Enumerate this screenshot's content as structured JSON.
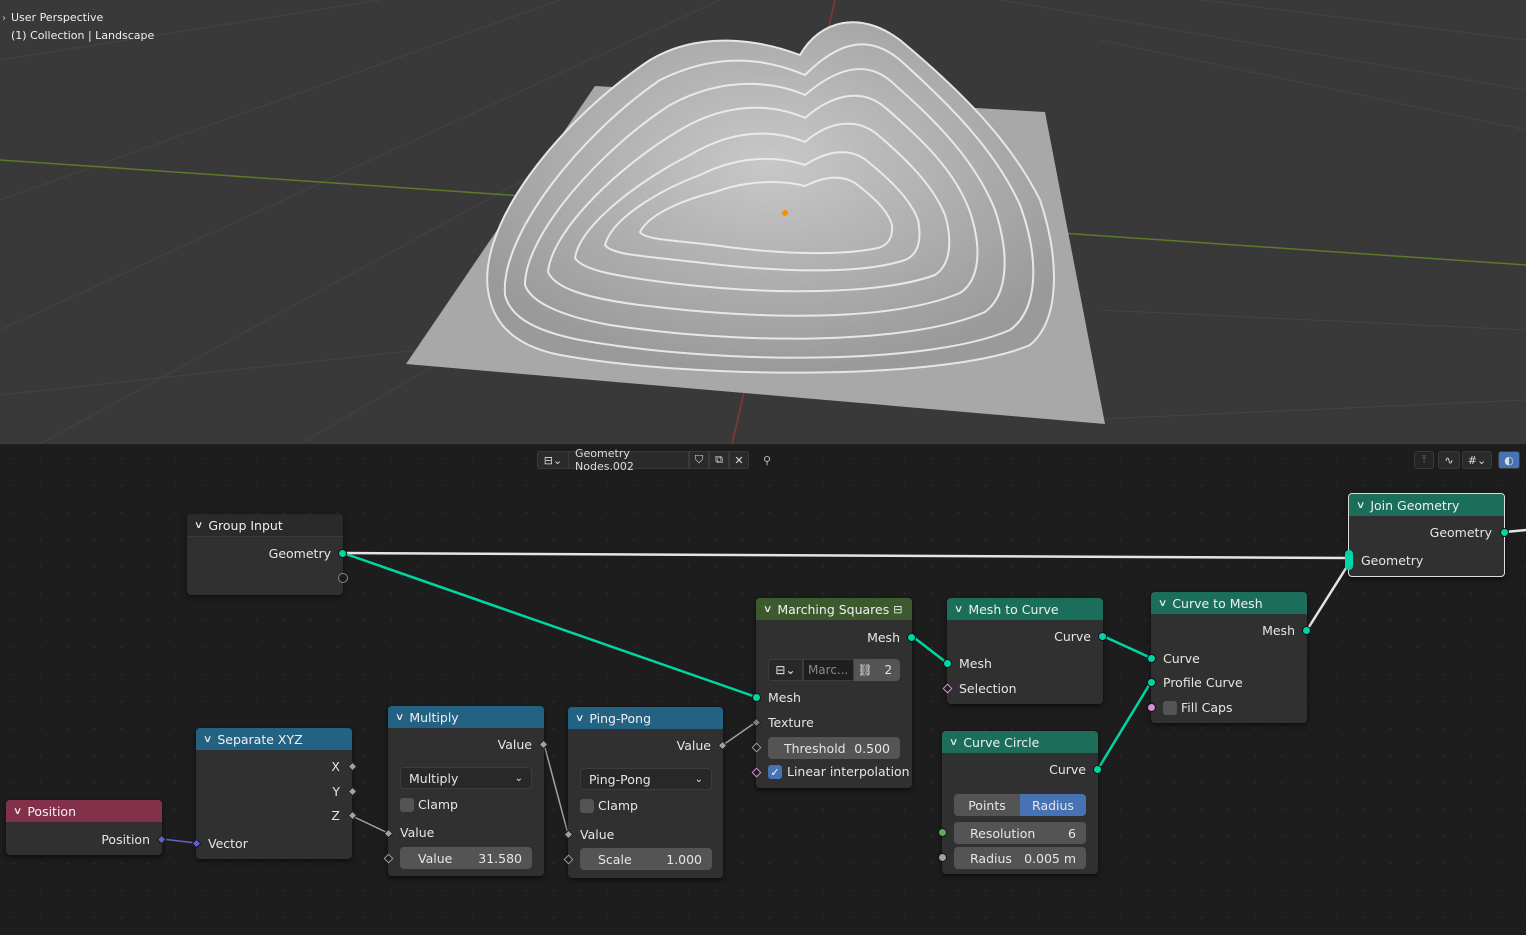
{
  "viewport": {
    "view_name": "User Perspective",
    "collection_label": "(1) Collection | Landscape"
  },
  "header": {
    "tree_name": "Geometry Nodes.002"
  },
  "nodes": {
    "group_input": {
      "title": "Group Input",
      "geometry": "Geometry"
    },
    "join_geometry": {
      "title": "Join Geometry",
      "out_geometry": "Geometry",
      "in_geometry": "Geometry"
    },
    "marching_squares": {
      "title": "Marching Squares",
      "out_mesh": "Mesh",
      "sub_name": "Marc...",
      "users": "2",
      "in_mesh": "Mesh",
      "texture": "Texture",
      "threshold_label": "Threshold",
      "threshold_value": "0.500",
      "linear_label": "Linear interpolation"
    },
    "mesh_to_curve": {
      "title": "Mesh to Curve",
      "out_curve": "Curve",
      "in_mesh": "Mesh",
      "selection": "Selection"
    },
    "curve_to_mesh": {
      "title": "Curve to Mesh",
      "out_mesh": "Mesh",
      "curve": "Curve",
      "profile_curve": "Profile Curve",
      "fill_caps": "Fill Caps"
    },
    "curve_circle": {
      "title": "Curve Circle",
      "out_curve": "Curve",
      "mode_points": "Points",
      "mode_radius": "Radius",
      "resolution_label": "Resolution",
      "resolution_value": "6",
      "radius_label": "Radius",
      "radius_value": "0.005 m"
    },
    "separate_xyz": {
      "title": "Separate XYZ",
      "x": "X",
      "y": "Y",
      "z": "Z",
      "vector": "Vector"
    },
    "position": {
      "title": "Position",
      "out": "Position"
    },
    "multiply": {
      "title": "Multiply",
      "out_value": "Value",
      "operation": "Multiply",
      "clamp": "Clamp",
      "in_value": "Value",
      "value_label": "Value",
      "value_value": "31.580"
    },
    "ping_pong": {
      "title": "Ping-Pong",
      "out_value": "Value",
      "operation": "Ping-Pong",
      "clamp": "Clamp",
      "in_value": "Value",
      "scale_label": "Scale",
      "scale_value": "1.000"
    }
  }
}
